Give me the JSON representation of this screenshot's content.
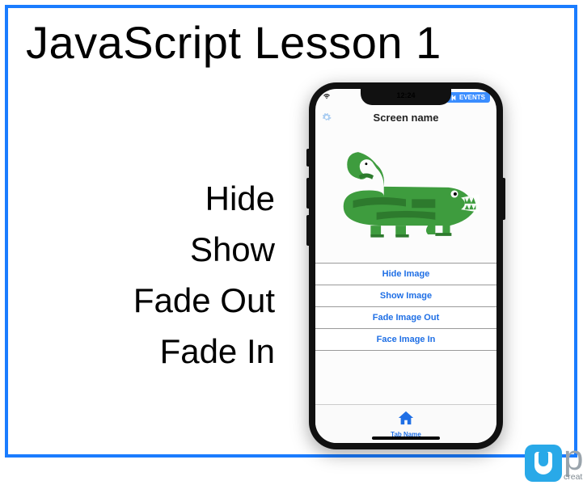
{
  "title": "JavaScript Lesson 1",
  "actions": [
    "Hide",
    "Show",
    "Fade Out",
    "Fade In"
  ],
  "phone": {
    "status": {
      "time": "12:24",
      "events_label": "EVENTS"
    },
    "screen_title": "Screen name",
    "image_alt": "crocodile",
    "buttons": [
      "Hide Image",
      "Show Image",
      "Fade Image Out",
      "Face Image In"
    ],
    "tab_label": "Tab Name"
  },
  "logo": {
    "letters": "pp",
    "tagline": "creative ap"
  }
}
